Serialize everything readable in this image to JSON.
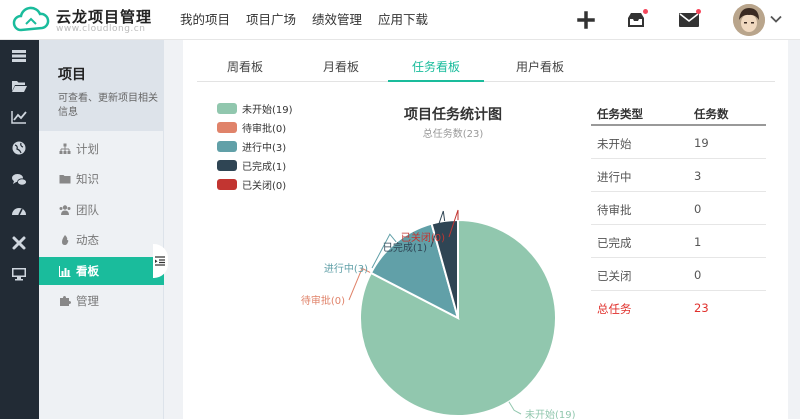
{
  "header": {
    "logo_title": "云龙项目管理",
    "logo_sub": "www.cloudlong.cn",
    "nav": [
      "我的项目",
      "项目广场",
      "绩效管理",
      "应用下载"
    ]
  },
  "sidebar": {
    "title": "项目",
    "desc": "可查看、更新项目相关信息",
    "items": [
      {
        "label": "计划",
        "icon": "sitemap-icon"
      },
      {
        "label": "知识",
        "icon": "folder-icon"
      },
      {
        "label": "团队",
        "icon": "users-icon"
      },
      {
        "label": "动态",
        "icon": "fire-icon"
      },
      {
        "label": "看板",
        "icon": "bar-chart-icon",
        "active": true
      },
      {
        "label": "管理",
        "icon": "puzzle-icon"
      }
    ]
  },
  "tabs": [
    "周看板",
    "月看板",
    "任务看板",
    "用户看板"
  ],
  "active_tab": 2,
  "colors": {
    "accent": "#1abc9c",
    "not_started": "#91c7ae",
    "pending": "#e0836a",
    "in_progress": "#61a0a8",
    "done": "#2f4554",
    "closed": "#c23531",
    "total_text": "#e0302c"
  },
  "chart_data": {
    "type": "pie",
    "title": "项目任务统计图",
    "subtitle": "总任务数(23)",
    "legend_position": "top-left",
    "series": [
      {
        "name": "未开始",
        "value": 19,
        "label": "未开始(19)",
        "color": "#91c7ae"
      },
      {
        "name": "待审批",
        "value": 0,
        "label": "待审批(0)",
        "color": "#e0836a"
      },
      {
        "name": "进行中",
        "value": 3,
        "label": "进行中(3)",
        "color": "#61a0a8"
      },
      {
        "name": "已完成",
        "value": 1,
        "label": "已完成(1)",
        "color": "#2f4554"
      },
      {
        "name": "已关闭",
        "value": 0,
        "label": "已关闭(0)",
        "color": "#c23531"
      }
    ]
  },
  "stats": {
    "header": [
      "任务类型",
      "任务数"
    ],
    "rows": [
      {
        "type": "未开始",
        "count": "19"
      },
      {
        "type": "进行中",
        "count": "3"
      },
      {
        "type": "待审批",
        "count": "0"
      },
      {
        "type": "已完成",
        "count": "1"
      },
      {
        "type": "已关闭",
        "count": "0"
      }
    ],
    "total": {
      "type": "总任务",
      "count": "23"
    }
  }
}
